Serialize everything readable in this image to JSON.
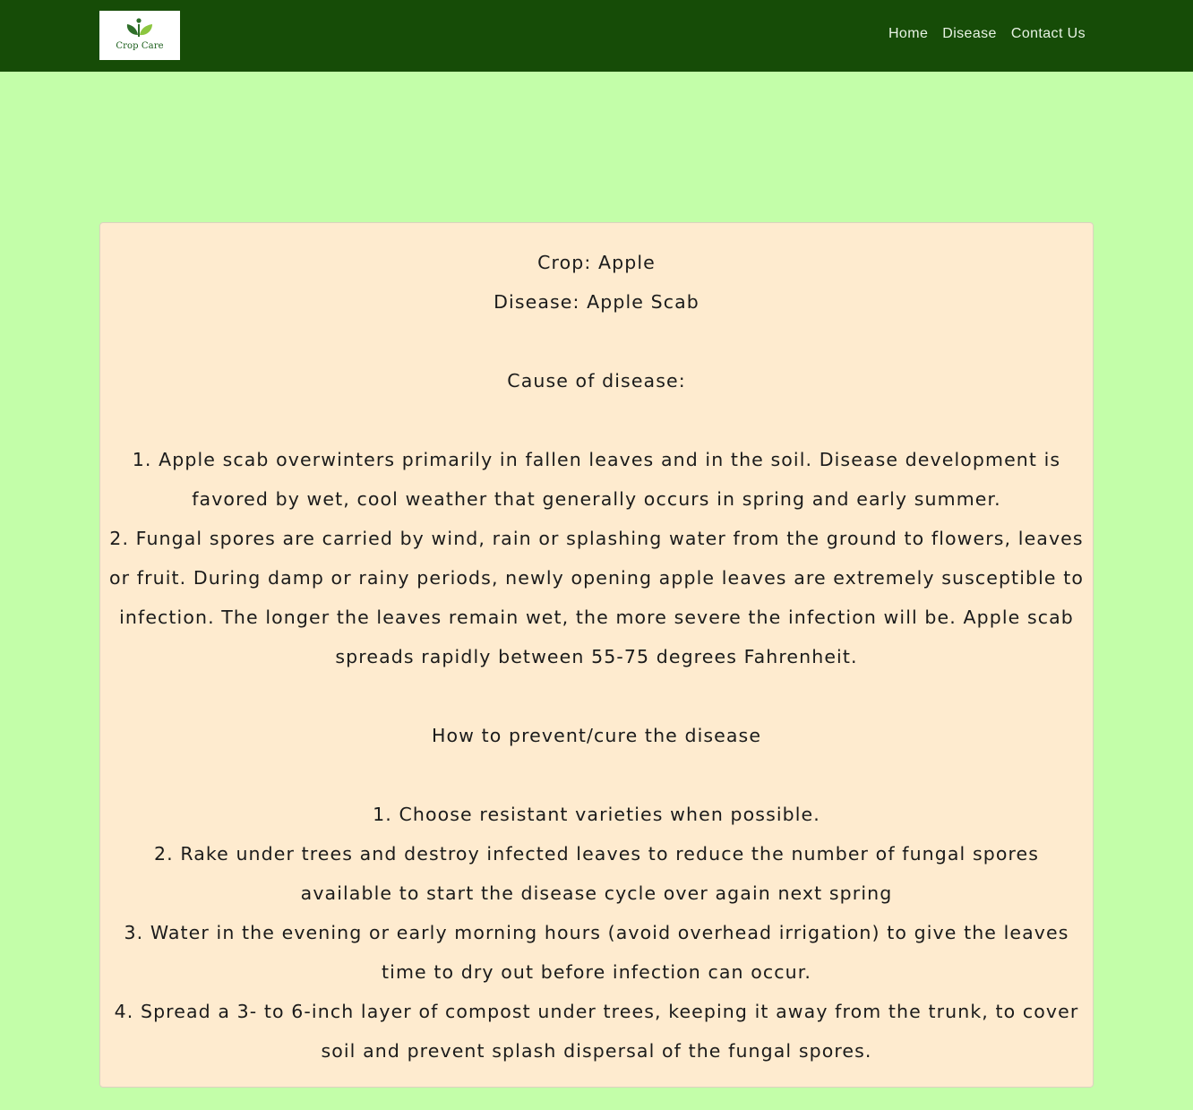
{
  "header": {
    "logo_text": "Crop Care",
    "nav": [
      {
        "label": "Home"
      },
      {
        "label": "Disease"
      },
      {
        "label": "Contact Us"
      }
    ]
  },
  "card": {
    "crop_line": "Crop: Apple",
    "disease_line": "Disease: Apple Scab",
    "cause_heading": "Cause of disease:",
    "causes": [
      "1. Apple scab overwinters primarily in fallen leaves and in the soil. Disease development is favored by wet, cool weather that generally occurs in spring and early summer.",
      "2. Fungal spores are carried by wind, rain or splashing water from the ground to flowers, leaves or fruit. During damp or rainy periods, newly opening apple leaves are extremely susceptible to infection. The longer the leaves remain wet, the more severe the infection will be. Apple scab spreads rapidly between 55-75 degrees Fahrenheit."
    ],
    "prevent_heading": "How to prevent/cure the disease",
    "preventions": [
      "1. Choose resistant varieties when possible.",
      "2. Rake under trees and destroy infected leaves to reduce the number of fungal spores available to start the disease cycle over again next spring",
      "3. Water in the evening or early morning hours (avoid overhead irrigation) to give the leaves time to dry out before infection can occur.",
      "4. Spread a 3- to 6-inch layer of compost under trees, keeping it away from the trunk, to cover soil and prevent splash dispersal of the fungal spores."
    ]
  },
  "colors": {
    "navbar": "#164c07",
    "page_background": "#c3fea9",
    "card_background": "#feebcf"
  }
}
